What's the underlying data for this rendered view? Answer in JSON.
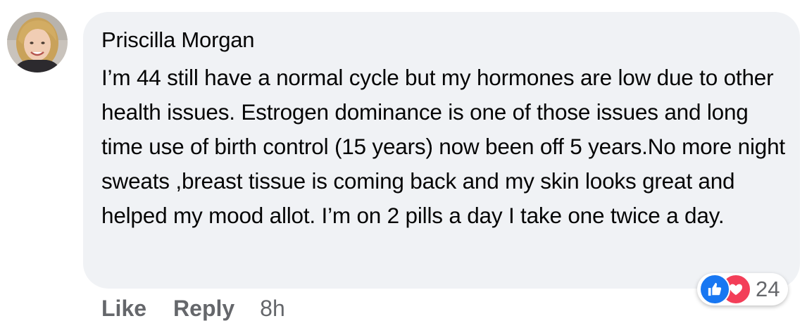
{
  "comment": {
    "author": "Priscilla Morgan",
    "text": "I’m 44 still have a normal cycle but my hormones are low due to other health issues. Estrogen dominance is one of those issues and long time use of birth control (15 years) now been off 5 years.No more night sweats ,breast tissue is coming back and my skin looks great and helped my mood allot. I’m on 2 pills a day I take one twice a day.",
    "reactions": {
      "icons": [
        "like-icon",
        "love-icon"
      ],
      "count": "24"
    },
    "actions": {
      "like_label": "Like",
      "reply_label": "Reply",
      "timestamp": "8h"
    }
  },
  "colors": {
    "bubble_bg": "#f0f2f5",
    "text": "#050505",
    "secondary_text": "#65676b",
    "like_blue": "#1877f2",
    "love_red": "#f33e58"
  }
}
